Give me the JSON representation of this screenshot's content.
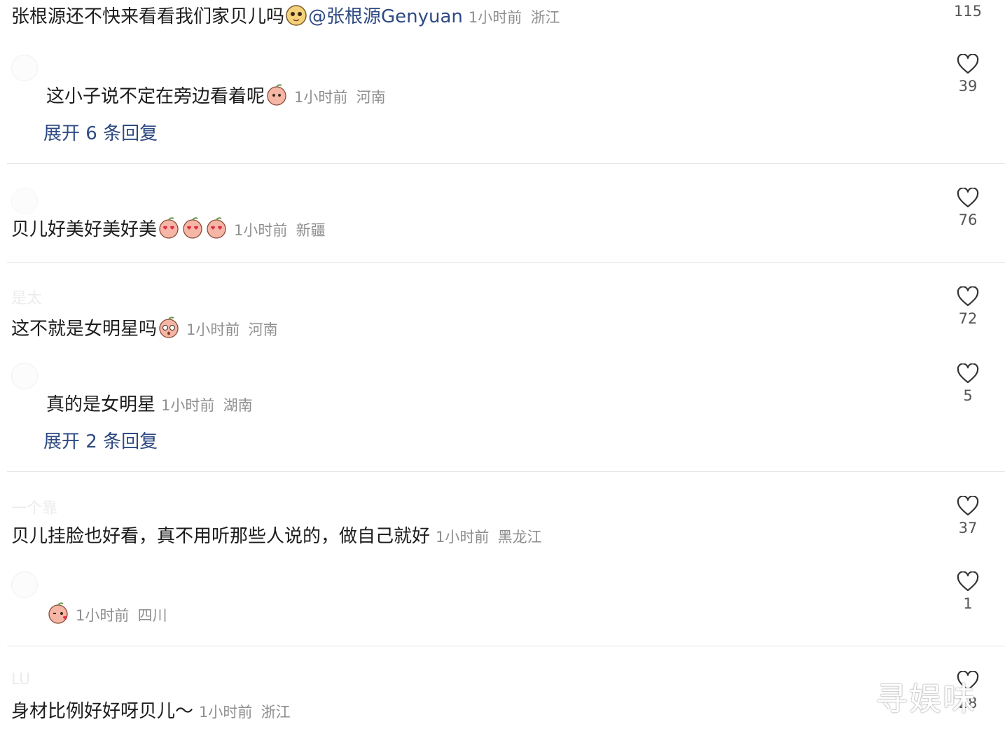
{
  "comments": [
    {
      "text": "张根源还不快来看看我们家贝儿吗",
      "mention": "@张根源Genyuan",
      "time": "1小时前",
      "location": "浙江",
      "likes": "115"
    },
    {
      "text": "这小子说不定在旁边看着呢",
      "time": "1小时前",
      "location": "河南",
      "likes": "39",
      "expand": "展开 6 条回复"
    },
    {
      "text": "贝儿好美好美好美",
      "time": "1小时前",
      "location": "新疆",
      "likes": "76"
    },
    {
      "username": "是太",
      "text": "这不就是女明星吗",
      "time": "1小时前",
      "location": "河南",
      "likes": "72"
    },
    {
      "text": "真的是女明星",
      "time": "1小时前",
      "location": "湖南",
      "likes": "5",
      "expand": "展开 2 条回复"
    },
    {
      "username": "一个靠",
      "text": "贝儿挂脸也好看，真不用听那些人说的，做自己就好",
      "time": "1小时前",
      "location": "黑龙江",
      "likes": "37"
    },
    {
      "text": "",
      "time": "1小时前",
      "location": "四川",
      "likes": "1"
    },
    {
      "username": "LU",
      "text": "身材比例好好呀贝儿～",
      "time": "1小时前",
      "location": "浙江",
      "likes": "28"
    }
  ],
  "watermark": "寻娱味",
  "icons": {
    "like": "heart-outline-icon",
    "emoji": "peach-emoji-icon"
  }
}
